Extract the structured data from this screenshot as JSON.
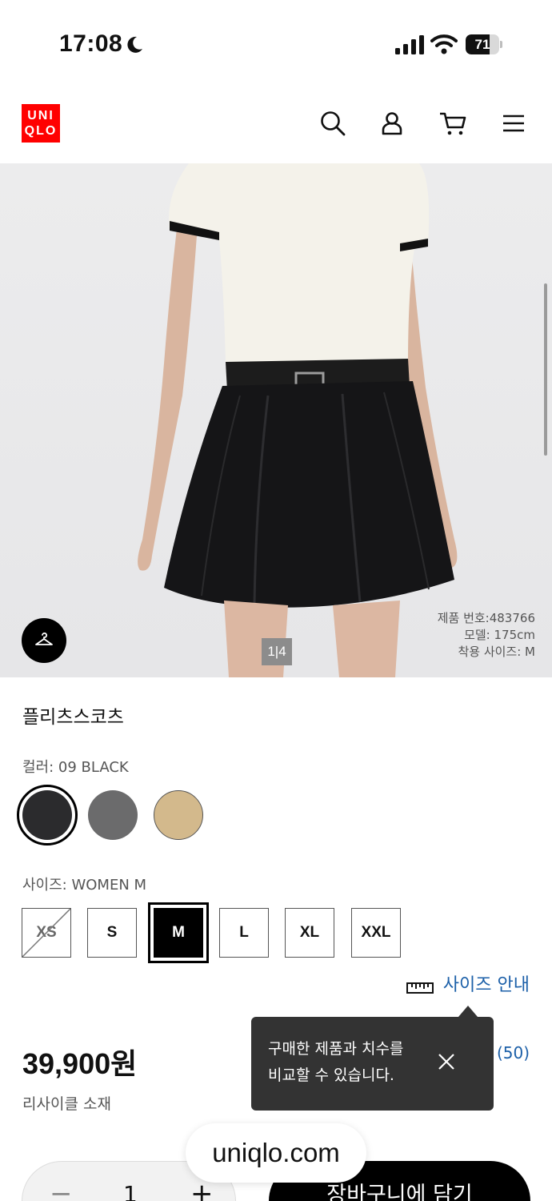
{
  "status_bar": {
    "time": "17:08",
    "battery": "71",
    "battery_level": 0.71
  },
  "header": {
    "logo_line1": "UNI",
    "logo_line2": "QLO",
    "brand_color": "#ff0000",
    "icons": [
      "search-icon",
      "account-icon",
      "cart-icon",
      "menu-icon"
    ]
  },
  "gallery": {
    "pager": "1|4",
    "product_number": "제품 번호:483766",
    "model": "모델: 175cm",
    "fit_size": "착용 사이즈: M"
  },
  "product": {
    "name": "플리츠스코츠",
    "color_label": "컬러: 09 BLACK",
    "swatch_colors": [
      "#2b2b2d",
      "#6b6b6c",
      "#d3b98c"
    ],
    "size_label": "사이즈: WOMEN M",
    "sizes": [
      "XS",
      "S",
      "M",
      "L",
      "XL",
      "XXL"
    ],
    "selected_size": "M",
    "unavailable_size": "XS",
    "size_guide": "사이즈 안내",
    "price": "39,900원",
    "price_note": "리사이클 소재",
    "review_count": "(50)",
    "link_color": "#1b5fa8"
  },
  "tooltip": {
    "line1": "구매한 제품과 치수를",
    "line2": "비교할 수 있습니다."
  },
  "bottom": {
    "url": "uniqlo.com",
    "qty_minus": "−",
    "qty_value": "1",
    "qty_plus": "+",
    "add_to_cart": "장바구니에 담기"
  }
}
